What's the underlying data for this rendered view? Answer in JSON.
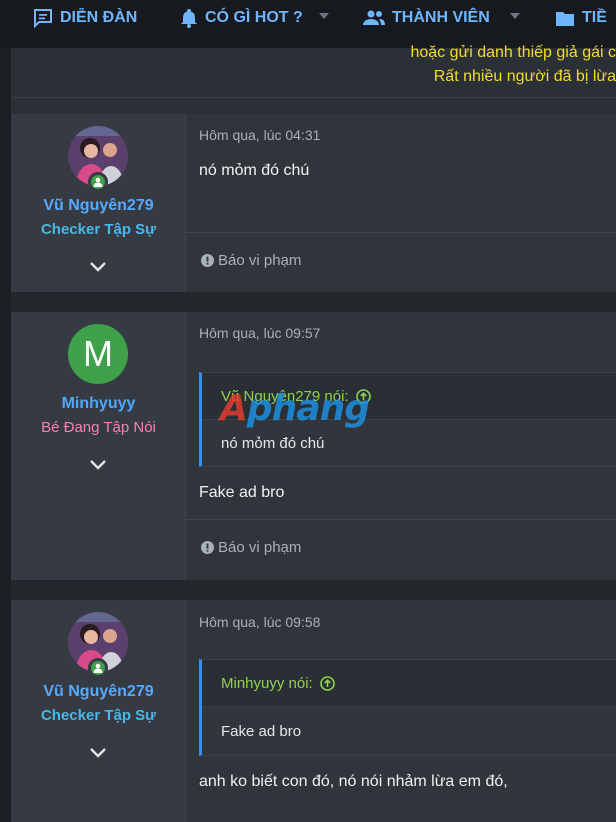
{
  "nav": {
    "items": [
      {
        "label": "DIỄN ĐÀN",
        "icon": "forum-icon"
      },
      {
        "label": "CÓ GÌ HOT ?",
        "icon": "bell-icon"
      },
      {
        "label": "THÀNH VIÊN",
        "icon": "members-icon"
      },
      {
        "label": "TIỀ",
        "icon": "folder-icon"
      }
    ]
  },
  "notice": {
    "line1": "hoặc gửi danh thiếp giả gái c",
    "line2": "Rất nhiều người đã bị lừa"
  },
  "watermark": {
    "text": "Aphang",
    "lead": "A",
    "rest": "phang"
  },
  "posts": [
    {
      "username": "Vũ Nguyên279",
      "user_title": "Checker Tập Sự",
      "date": "Hôm qua, lúc 04:31",
      "text": "nó mỏm đó chú",
      "report": "Báo vi phạm"
    },
    {
      "avatar_letter": "M",
      "username": "Minhyuyy",
      "user_title": "Bé Đang Tập Nói",
      "date": "Hôm qua, lúc 09:57",
      "quote": {
        "author": "Vũ Nguyên279 nói:",
        "text": "nó mỏm đó chú"
      },
      "text": "Fake ad bro",
      "report": "Báo vi phạm"
    },
    {
      "username": "Vũ Nguyên279",
      "user_title": "Checker Tập Sự",
      "date": "Hôm qua, lúc 09:58",
      "quote": {
        "author": "Minhyuyy nói:",
        "text": "Fake ad bro"
      },
      "text": "anh ko biết con đó, nó nói nhảm lừa em đó,"
    }
  ],
  "colors": {
    "nav_link": "#6fb6ff",
    "notice_text": "#f0dc2a",
    "username": "#55aaff",
    "checker_title": "#48b8e8",
    "newbie_title": "#ff7eb6",
    "quote_author": "#8fd14f",
    "quote_border": "#3a8ee6",
    "online": "#3fa149"
  }
}
